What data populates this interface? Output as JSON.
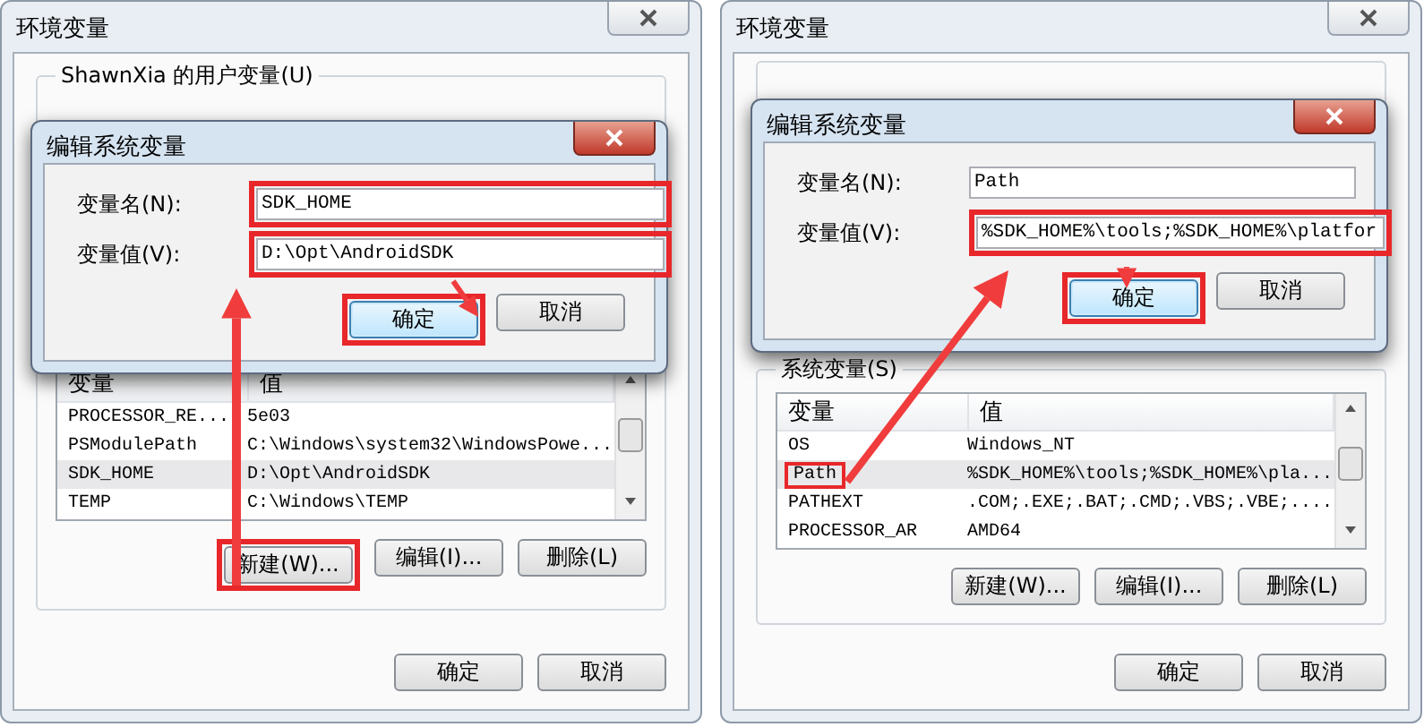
{
  "panels": [
    {
      "window": {
        "title": "环境变量"
      },
      "user_group": {
        "label": "ShawnXia 的用户变量(U)"
      },
      "editor": {
        "title": "编辑系统变量",
        "fields": [
          {
            "label": "变量名(N):",
            "value": "SDK_HOME",
            "highlighted": true
          },
          {
            "label": "变量值(V):",
            "value": "D:\\Opt\\AndroidSDK",
            "highlighted": true
          }
        ],
        "buttons": [
          {
            "label": "确定",
            "default": true,
            "highlighted": true
          },
          {
            "label": "取消",
            "default": false,
            "highlighted": false
          }
        ]
      },
      "system_group": {
        "columns": [
          "变量",
          "值"
        ],
        "rows": [
          {
            "name": "PROCESSOR_RE...",
            "value": "5e03",
            "selected": false,
            "highlighted": false
          },
          {
            "name": "PSModulePath",
            "value": "C:\\Windows\\system32\\WindowsPowe...",
            "selected": false,
            "highlighted": false
          },
          {
            "name": "SDK_HOME",
            "value": "D:\\Opt\\AndroidSDK",
            "selected": true,
            "highlighted": false
          },
          {
            "name": "TEMP",
            "value": "C:\\Windows\\TEMP",
            "selected": false,
            "highlighted": false
          }
        ],
        "buttons": [
          {
            "label": "新建(W)...",
            "highlighted": true
          },
          {
            "label": "编辑(I)...",
            "highlighted": false
          },
          {
            "label": "删除(L)",
            "highlighted": false
          }
        ]
      },
      "dialog_buttons": [
        "确定",
        "取消"
      ]
    },
    {
      "window": {
        "title": "环境变量"
      },
      "editor": {
        "title": "编辑系统变量",
        "fields": [
          {
            "label": "变量名(N):",
            "value": "Path",
            "highlighted": false
          },
          {
            "label": "变量值(V):",
            "value": "%SDK_HOME%\\tools;%SDK_HOME%\\platfor",
            "highlighted": true
          }
        ],
        "buttons": [
          {
            "label": "确定",
            "default": true,
            "highlighted": true
          },
          {
            "label": "取消",
            "default": false,
            "highlighted": false
          }
        ]
      },
      "system_group": {
        "label": "系统变量(S)",
        "columns": [
          "变量",
          "值"
        ],
        "rows": [
          {
            "name": "OS",
            "value": "Windows_NT",
            "selected": false,
            "highlighted": false
          },
          {
            "name": "Path",
            "value": "%SDK_HOME%\\tools;%SDK_HOME%\\pla...",
            "selected": true,
            "highlighted": true
          },
          {
            "name": "PATHEXT",
            "value": ".COM;.EXE;.BAT;.CMD;.VBS;.VBE;....",
            "selected": false,
            "highlighted": false
          },
          {
            "name": "PROCESSOR_AR",
            "value": "AMD64",
            "selected": false,
            "highlighted": false
          }
        ],
        "buttons": [
          {
            "label": "新建(W)...",
            "highlighted": false
          },
          {
            "label": "编辑(I)...",
            "highlighted": false
          },
          {
            "label": "删除(L)",
            "highlighted": false
          }
        ]
      },
      "dialog_buttons": [
        "确定",
        "取消"
      ]
    }
  ]
}
